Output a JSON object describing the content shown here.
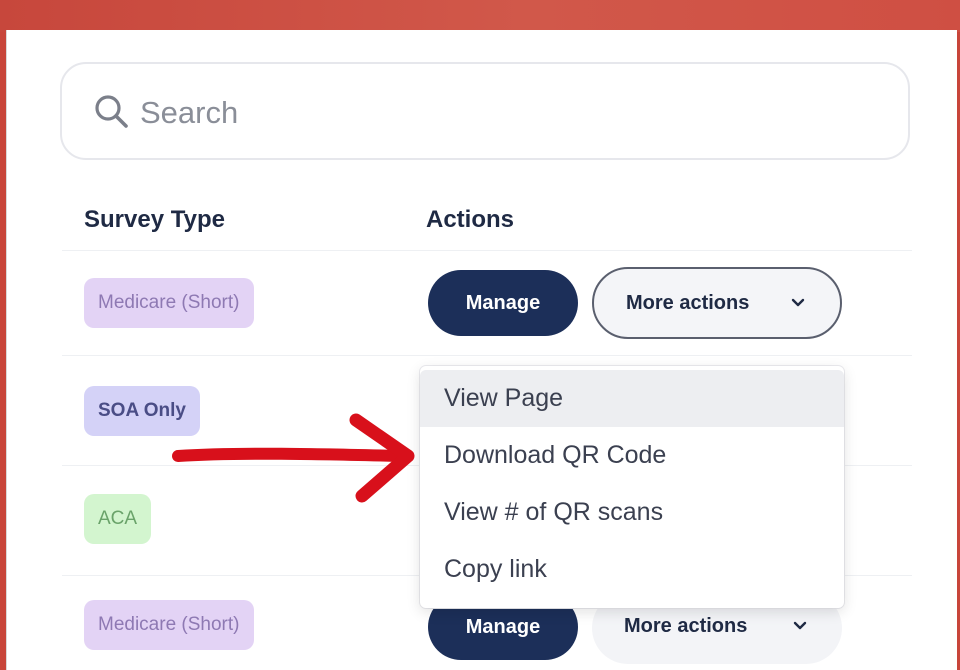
{
  "search": {
    "placeholder": "Search",
    "icon": "search-icon"
  },
  "table": {
    "headers": {
      "survey_type": "Survey Type",
      "actions": "Actions"
    },
    "rows": [
      {
        "survey_type": "Medicare (Short)",
        "manage_label": "Manage",
        "more_label": "More actions"
      },
      {
        "survey_type": "SOA Only"
      },
      {
        "survey_type": "ACA"
      },
      {
        "survey_type": "Medicare (Short)",
        "manage_label": "Manage",
        "more_label": "More actions"
      }
    ]
  },
  "dropdown": {
    "items": [
      "View Page",
      "Download QR Code",
      "View # of QR scans",
      "Copy link"
    ],
    "highlighted_index": 0
  },
  "annotation": {
    "type": "arrow",
    "color": "#d8101b"
  },
  "colors": {
    "manage_button": "#1c2f59",
    "medicare_badge": "#e3d3f5",
    "soa_badge": "#d4d2f7",
    "aca_badge": "#d3f5cf",
    "header_bar": "#c8453a"
  }
}
